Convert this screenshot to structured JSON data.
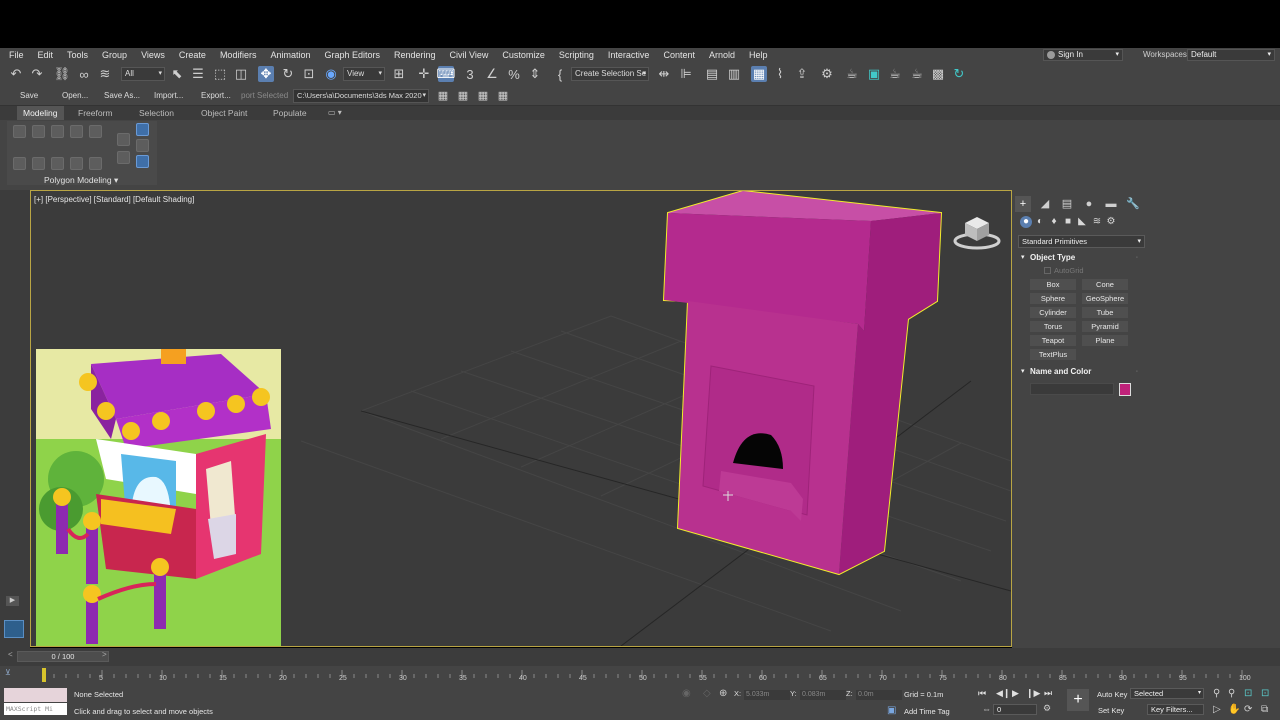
{
  "menu": [
    "File",
    "Edit",
    "Tools",
    "Group",
    "Views",
    "Create",
    "Modifiers",
    "Animation",
    "Graph Editors",
    "Rendering",
    "Civil View",
    "Customize",
    "Scripting",
    "Interactive",
    "Content",
    "Arnold",
    "Help"
  ],
  "account": {
    "sign_in": "Sign In",
    "workspaces_label": "Workspaces:",
    "workspace": "Default"
  },
  "toolbar": {
    "filter": "All",
    "ref_coord": "View",
    "selection_set": "Create Selection Se"
  },
  "toolbar2": {
    "save": "Save",
    "open": "Open...",
    "save_as": "Save As...",
    "import": "Import...",
    "export": "Export...",
    "export_selected": "port Selected",
    "project_path": "C:\\Users\\a\\Documents\\3ds Max 2020"
  },
  "ribbon": {
    "tabs": [
      "Modeling",
      "Freeform",
      "Selection",
      "Object Paint",
      "Populate"
    ],
    "panel_label": "Polygon Modeling"
  },
  "viewport": {
    "label": "[+] [Perspective] [Standard] [Default Shading]"
  },
  "command_panel": {
    "category": "Standard Primitives",
    "object_type_title": "Object Type",
    "autogrid": "AutoGrid",
    "buttons": [
      "Box",
      "Cone",
      "Sphere",
      "GeoSphere",
      "Cylinder",
      "Tube",
      "Torus",
      "Pyramid",
      "Teapot",
      "Plane",
      "TextPlus"
    ],
    "name_color_title": "Name and Color",
    "object_color": "#c0227a"
  },
  "timeline": {
    "slider": "0 / 100",
    "frames": [
      "0",
      "5",
      "10",
      "15",
      "20",
      "25",
      "30",
      "35",
      "40",
      "45",
      "50",
      "55",
      "60",
      "65",
      "70",
      "75",
      "80",
      "85",
      "90",
      "95",
      "100"
    ]
  },
  "status": {
    "maxscript": "MAXScript Mi",
    "selection": "None Selected",
    "prompt": "Click and drag to select and move objects",
    "x_label": "X:",
    "x_value": "5.033m",
    "y_label": "Y:",
    "y_value": "0.083m",
    "z_label": "Z:",
    "z_value": "0.0m",
    "grid": "Grid = 0.1m",
    "add_time_tag": "Add Time Tag",
    "frame_field": "0",
    "auto_key": "Auto Key",
    "set_key": "Set Key",
    "selected": "Selected",
    "key_filters": "Key Filters..."
  },
  "colors": {
    "model": "#c0227a",
    "selection_outline": "#f1ee2b",
    "viewport_bg": "#3b3b3b"
  }
}
